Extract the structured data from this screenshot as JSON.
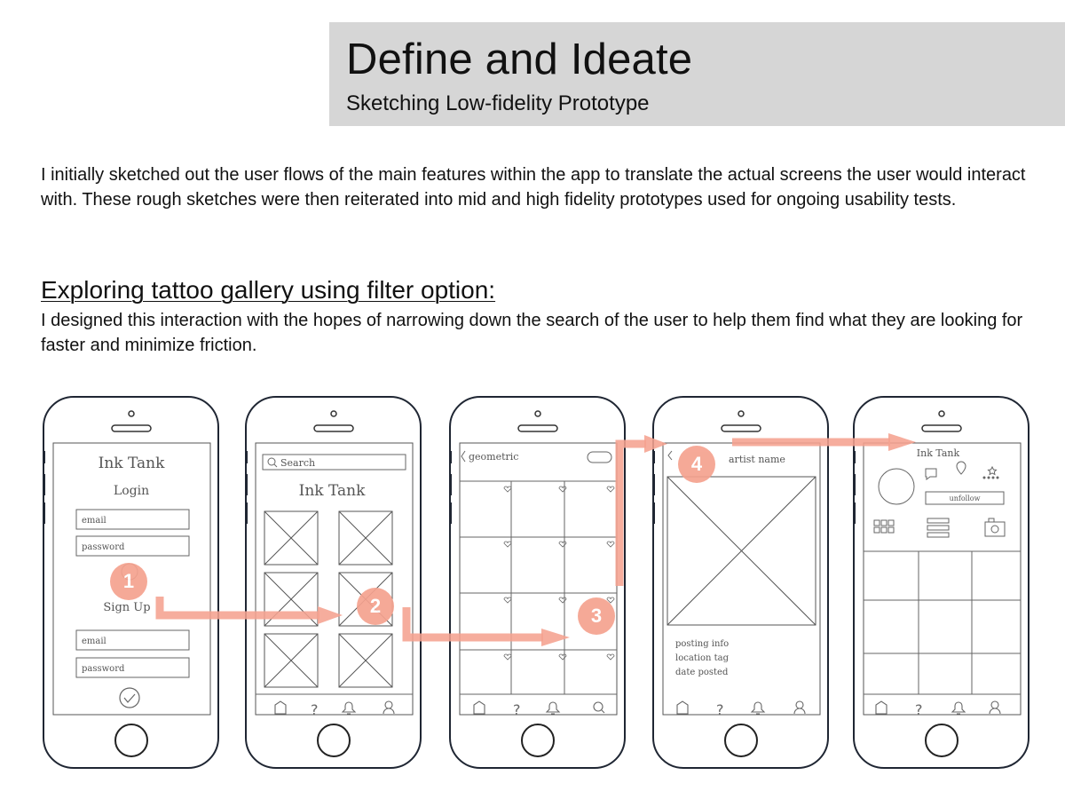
{
  "header": {
    "title": "Define and Ideate",
    "subtitle": "Sketching Low-fidelity Prototype"
  },
  "intro_text": "I initially sketched out the user flows of the main features within the app to translate the actual screens the user would interact with. These rough sketches were then reiterated into mid and high fidelity prototypes used for ongoing usability tests.",
  "section": {
    "heading": "Exploring tattoo gallery using filter option:",
    "description": "I designed this interaction with the hopes of narrowing down the search of the user to help them find what they are looking for faster and minimize friction."
  },
  "flow_steps": [
    "1",
    "2",
    "3",
    "4"
  ],
  "phones": {
    "login": {
      "app_name": "Ink Tank",
      "login_label": "Login",
      "email_placeholder": "email",
      "password_placeholder": "password",
      "signup_label": "Sign Up",
      "signup_email_placeholder": "email",
      "signup_password_placeholder": "password"
    },
    "search": {
      "search_placeholder": "Search",
      "app_name": "Ink Tank"
    },
    "gallery": {
      "filter_label": "geometric"
    },
    "detail": {
      "artist_label": "artist name",
      "notes_line1": "posting info",
      "notes_line2": "location tag",
      "notes_line3": "date posted"
    },
    "profile": {
      "app_name": "Ink Tank",
      "unfollow_label": "unfollow"
    }
  },
  "colors": {
    "title_band": "#d6d6d6",
    "flow_arrow": "#f5a28f",
    "phone_outline": "#1f2633",
    "sketch_stroke": "#666666"
  },
  "icons": [
    "home-icon",
    "question-icon",
    "bell-icon",
    "user-icon",
    "check-icon",
    "search-icon",
    "chat-icon",
    "location-pin-icon",
    "star-icon",
    "grid-icon",
    "list-icon",
    "camera-icon"
  ]
}
